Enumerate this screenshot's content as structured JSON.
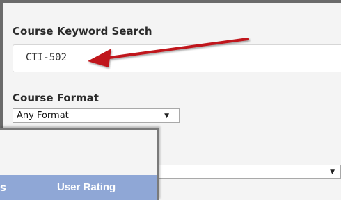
{
  "search": {
    "label": "Course Keyword Search",
    "value": "CTI-502"
  },
  "format": {
    "label": "Course Format",
    "selected": "Any Format"
  },
  "tabs": {
    "partial_label": "s",
    "user_rating_label": "User Rating"
  },
  "icons": {
    "caret": "caret-down-icon",
    "annotation": "red-arrow-annotation"
  },
  "colors": {
    "tab_bg": "#8fa7d6",
    "arrow": "#c0181c",
    "frame": "#6b6b6b"
  }
}
